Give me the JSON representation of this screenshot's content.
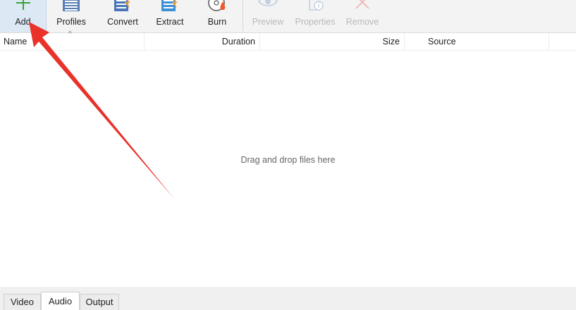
{
  "toolbar": {
    "buttons": [
      {
        "label": "Add",
        "icon": "plus-icon",
        "state": "active"
      },
      {
        "label": "Profiles",
        "icon": "profiles-icon",
        "state": "enabled"
      },
      {
        "label": "Convert",
        "icon": "convert-icon",
        "state": "enabled"
      },
      {
        "label": "Extract",
        "icon": "extract-icon",
        "state": "enabled"
      },
      {
        "label": "Burn",
        "icon": "disc-burn-icon",
        "state": "enabled"
      },
      {
        "label": "Preview",
        "icon": "eye-icon",
        "state": "disabled"
      },
      {
        "label": "Properties",
        "icon": "info-document-icon",
        "state": "disabled"
      },
      {
        "label": "Remove",
        "icon": "x-icon",
        "state": "disabled"
      }
    ]
  },
  "list": {
    "columns": {
      "name": "Name",
      "duration": "Duration",
      "size": "Size",
      "source": "Source"
    },
    "sort_indicator": "^",
    "empty_text": "Drag and drop files here"
  },
  "tabs": [
    {
      "label": "Video",
      "active": false
    },
    {
      "label": "Audio",
      "active": true
    },
    {
      "label": "Output",
      "active": false
    }
  ],
  "colors": {
    "accent_green": "#3aa23a",
    "annotation_arrow": "#e8322a",
    "toolbar_bg": "#f3f3f3",
    "active_button_bg": "#dce8f4"
  }
}
